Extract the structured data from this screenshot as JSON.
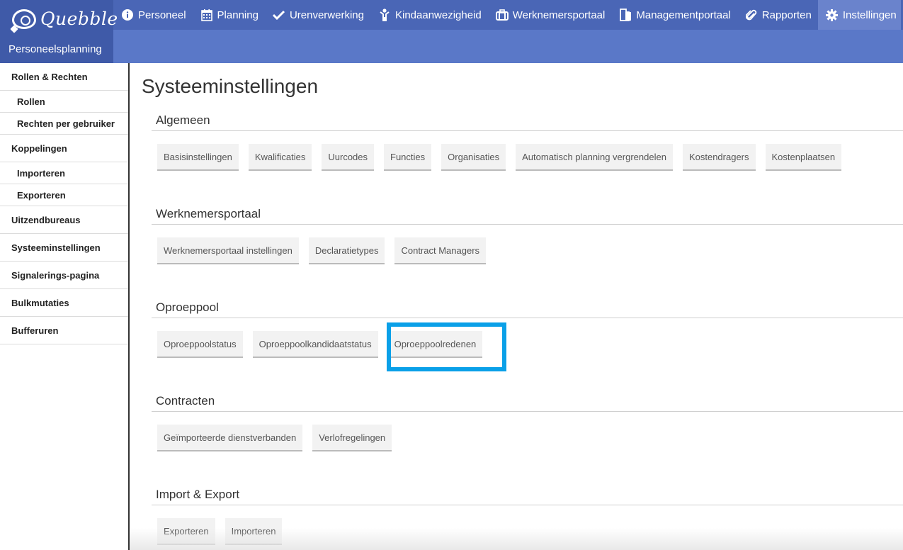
{
  "brand": {
    "logo_text": "Quebble",
    "app_name": "Personeelsplanning"
  },
  "nav": [
    {
      "label": "Personeel",
      "icon": "info-icon"
    },
    {
      "label": "Planning",
      "icon": "calendar-icon"
    },
    {
      "label": "Urenverwerking",
      "icon": "check-icon"
    },
    {
      "label": "Kindaanwezigheid",
      "icon": "child-icon"
    },
    {
      "label": "Werknemersportaal",
      "icon": "briefcase-icon"
    },
    {
      "label": "Managementportaal",
      "icon": "documents-icon"
    },
    {
      "label": "Rapporten",
      "icon": "paperclip-icon"
    },
    {
      "label": "Instellingen",
      "icon": "gear-icon",
      "active": true
    }
  ],
  "sidebar": {
    "items": [
      {
        "label": "Rollen & Rechten"
      },
      {
        "label": "Rollen",
        "sub": true
      },
      {
        "label": "Rechten per gebruiker",
        "sub": true
      },
      {
        "label": "Koppelingen"
      },
      {
        "label": "Importeren",
        "sub": true
      },
      {
        "label": "Exporteren",
        "sub": true
      },
      {
        "label": "Uitzendbureaus"
      },
      {
        "label": "Systeeminstellingen"
      },
      {
        "label": "Signalerings-pagina"
      },
      {
        "label": "Bulkmutaties"
      },
      {
        "label": "Bufferuren"
      }
    ]
  },
  "main": {
    "title": "Systeeminstellingen",
    "sections": [
      {
        "title": "Algemeen",
        "buttons": [
          "Basisinstellingen",
          "Kwalificaties",
          "Uurcodes",
          "Functies",
          "Organisaties",
          "Automatisch planning vergrendelen",
          "Kostendragers",
          "Kostenplaatsen"
        ]
      },
      {
        "title": "Werknemersportaal",
        "buttons": [
          "Werknemersportaal instellingen",
          "Declaratietypes",
          "Contract Managers"
        ]
      },
      {
        "title": "Oproeppool",
        "buttons": [
          "Oproeppoolstatus",
          "Oproeppoolkandidaatstatus",
          "Oproeppoolredenen"
        ]
      },
      {
        "title": "Contracten",
        "buttons": [
          "Geïmporteerde dienstverbanden",
          "Verlofregelingen"
        ]
      },
      {
        "title": "Import & Export",
        "buttons": [
          "Exporteren",
          "Importeren"
        ]
      }
    ]
  },
  "colors": {
    "nav_bg": "#4a66b6",
    "subbar_bg": "#5a78c8",
    "active_nav": "#6a83cc",
    "highlight": "#0aa0e8"
  }
}
